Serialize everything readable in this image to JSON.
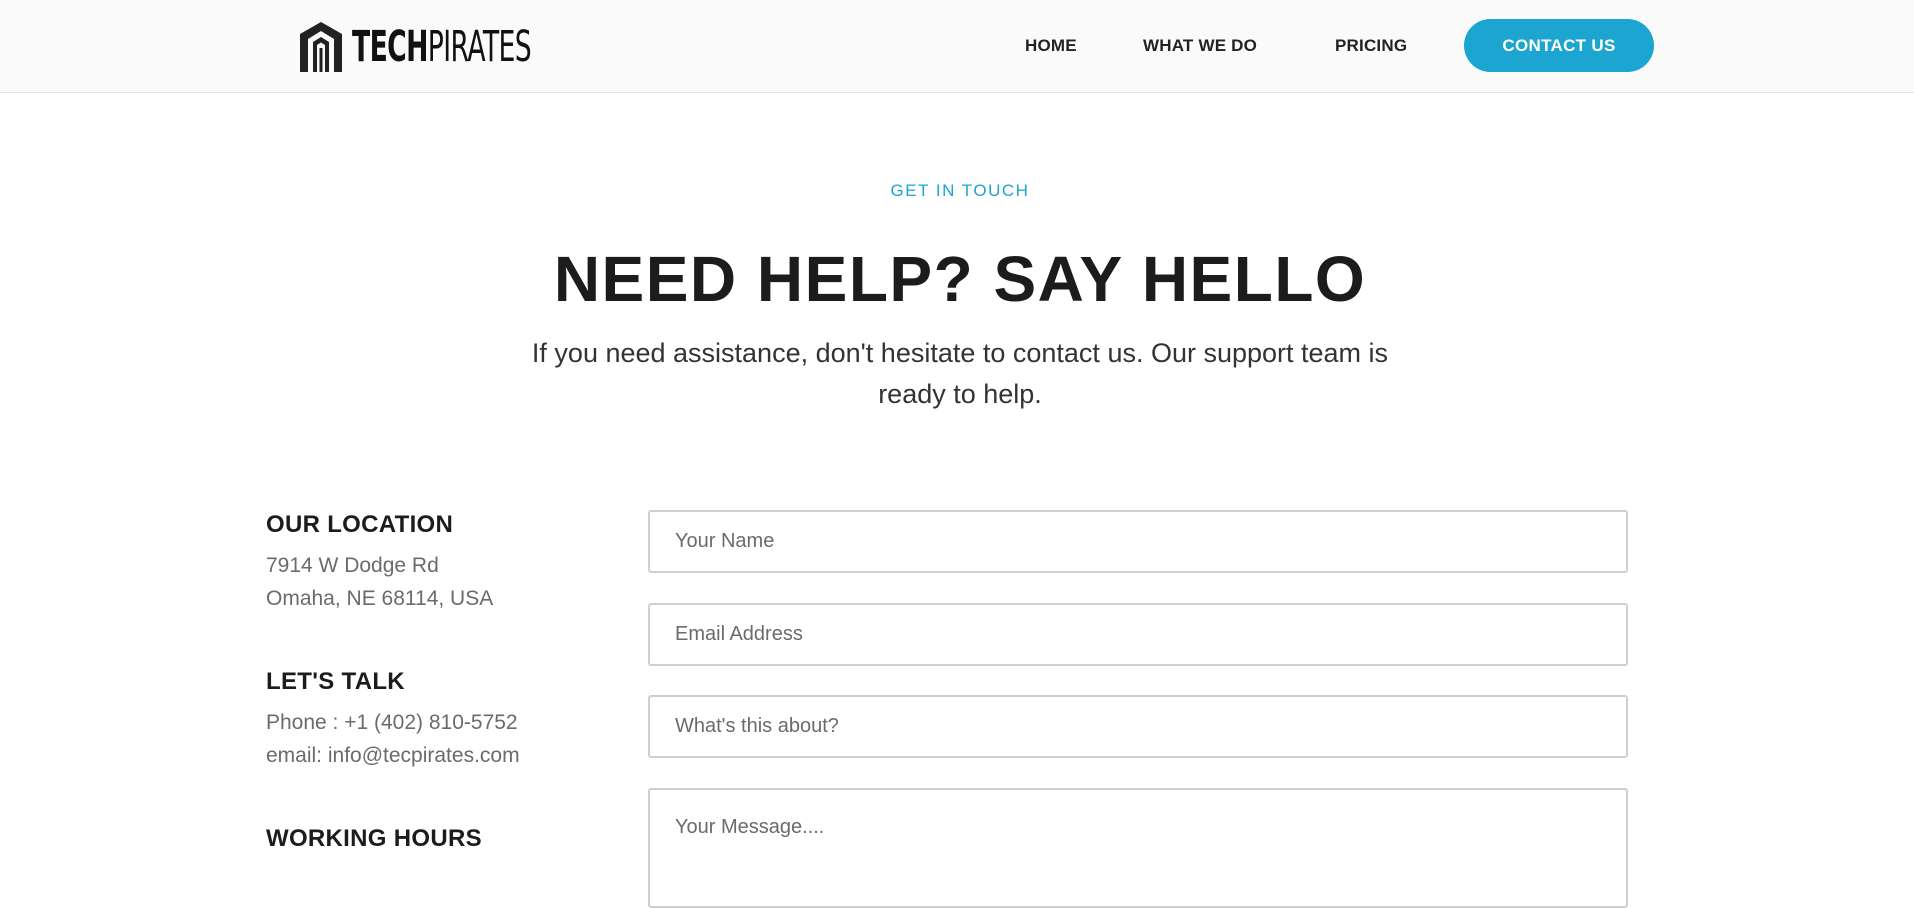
{
  "brand": {
    "logo_bold": "TECH",
    "logo_light": "PIRATES",
    "accent_color": "#1ba5d0"
  },
  "nav": {
    "items": [
      {
        "label": "HOME"
      },
      {
        "label": "WHAT WE DO"
      },
      {
        "label": "PRICING"
      }
    ],
    "cta_label": "CONTACT US"
  },
  "hero": {
    "eyebrow": "GET IN TOUCH",
    "title": "NEED HELP? SAY HELLO",
    "subtitle": "If you need assistance, don't hesitate to contact us. Our support team is ready to help."
  },
  "info": {
    "location_heading": "OUR LOCATION",
    "address_line1": "7914 W Dodge Rd",
    "address_line2": "Omaha, NE 68114, USA",
    "talk_heading": "LET'S TALK",
    "phone": "Phone : +1 (402) 810-5752",
    "email": "email: info@tecpirates.com",
    "hours_heading": "WORKING HOURS"
  },
  "form": {
    "name_placeholder": "Your Name",
    "email_placeholder": "Email Address",
    "subject_placeholder": "What's this about?",
    "message_placeholder": "Your Message...."
  }
}
